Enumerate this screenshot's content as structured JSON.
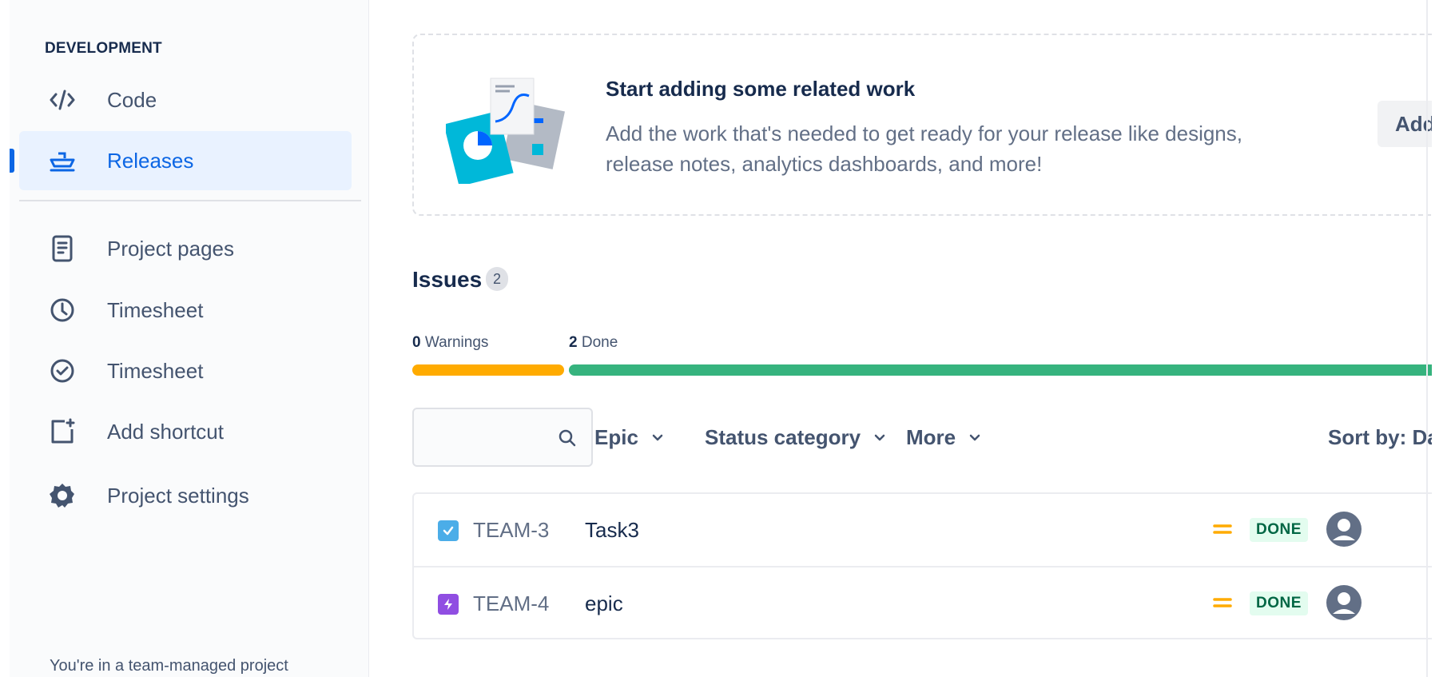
{
  "sidebar": {
    "section_title": "DEVELOPMENT",
    "items": [
      {
        "label": "Code",
        "icon": "code-icon"
      },
      {
        "label": "Releases",
        "icon": "ship-icon",
        "active": true
      },
      {
        "label": "Project pages",
        "icon": "page-icon"
      },
      {
        "label": "Timesheet",
        "icon": "clock-icon"
      },
      {
        "label": "Timesheet",
        "icon": "check-circle-icon"
      },
      {
        "label": "Add shortcut",
        "icon": "add-shortcut-icon"
      },
      {
        "label": "Project settings",
        "icon": "gear-icon"
      }
    ],
    "footer": "You're in a team-managed project"
  },
  "related_work": {
    "title": "Start adding some related work",
    "description": "Add the work that's needed to get ready for your release like designs, release notes, analytics dashboards, and more!",
    "button_label": "Add rela"
  },
  "issues": {
    "title": "Issues",
    "count": "2",
    "warnings_count": "0",
    "warnings_label": "Warnings",
    "done_count": "2",
    "done_label": "Done",
    "progress": {
      "warnings_fraction": 0.0,
      "done_fraction": 1.0
    },
    "filters": {
      "epic": "Epic",
      "status_category": "Status category",
      "more": "More",
      "sort_by": "Sort by: Da"
    },
    "rows": [
      {
        "key": "TEAM-3",
        "summary": "Task3",
        "type_icon": "task-checkbox-icon",
        "priority_icon": "medium-priority-icon",
        "status": "DONE"
      },
      {
        "key": "TEAM-4",
        "summary": "epic",
        "type_icon": "epic-lightning-icon",
        "priority_icon": "medium-priority-icon",
        "status": "DONE"
      }
    ]
  },
  "colors": {
    "accent": "#0c66e4",
    "warning_bar": "#ffab00",
    "done_bar": "#36b37e",
    "task_icon": "#4bade8",
    "epic_icon": "#904ee2",
    "priority": "#ffab00"
  }
}
